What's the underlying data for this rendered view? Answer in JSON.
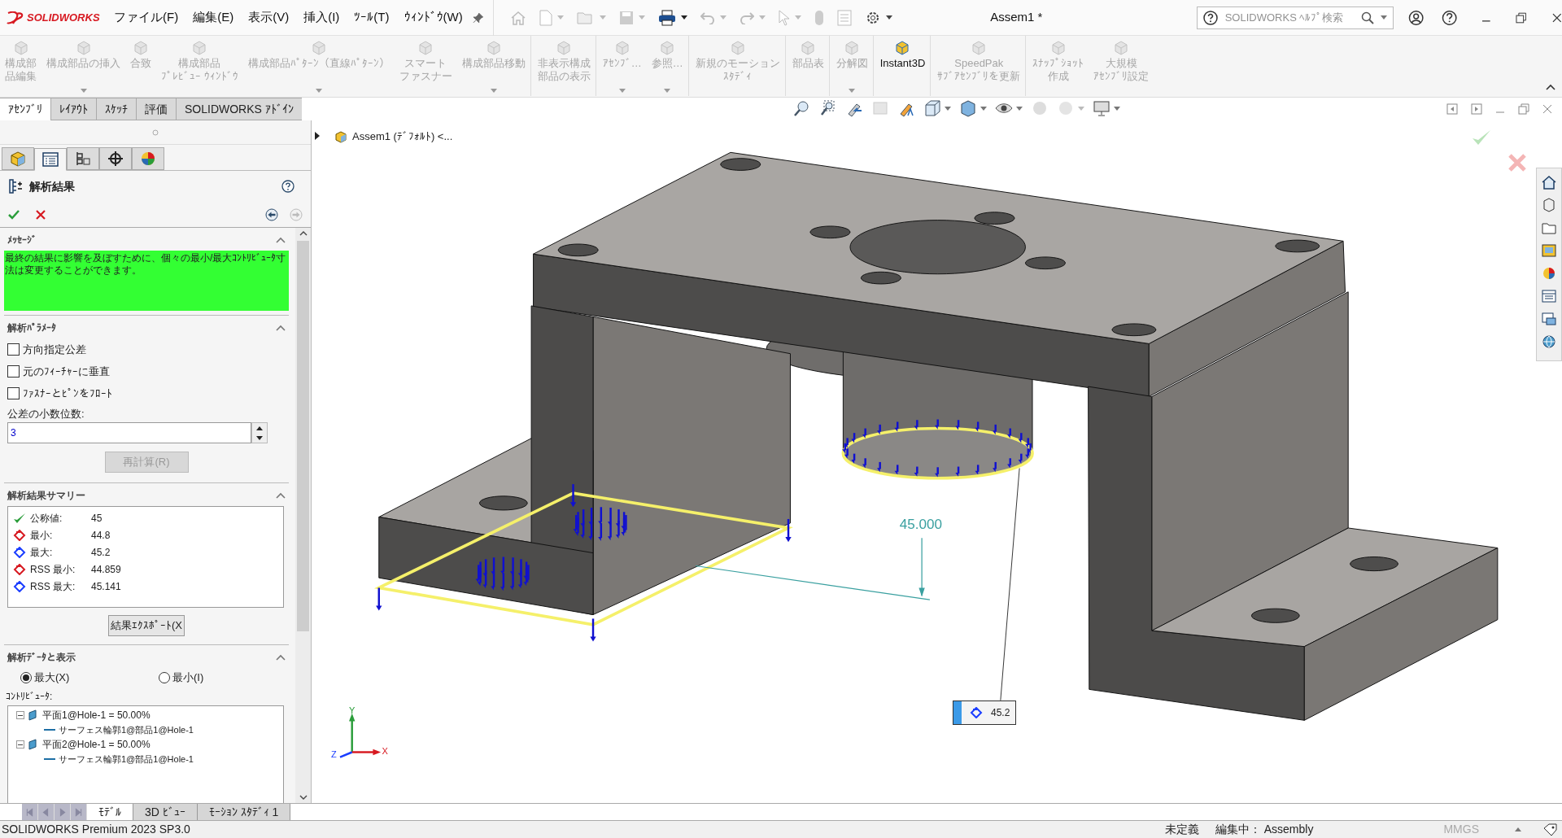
{
  "app": {
    "logo": "SOLIDWORKS"
  },
  "menu": [
    {
      "label": "ファイル(F)"
    },
    {
      "label": "編集(E)"
    },
    {
      "label": "表示(V)"
    },
    {
      "label": "挿入(I)"
    },
    {
      "label": "ﾂｰﾙ(T)"
    },
    {
      "label": "ｳｨﾝﾄﾞｳ(W)"
    }
  ],
  "title": "Assem1 *",
  "help_search": {
    "placeholder": "SOLIDWORKS ﾍﾙﾌﾟ検索"
  },
  "ribbon": [
    {
      "lines": [
        "構成部",
        "品編集"
      ],
      "disabled": true,
      "menu": false,
      "separator_after": false
    },
    {
      "lines": [
        "構成部品の挿入"
      ],
      "disabled": true,
      "menu": true,
      "separator_after": false
    },
    {
      "lines": [
        "合致"
      ],
      "disabled": true,
      "menu": false,
      "separator_after": false
    },
    {
      "lines": [
        "構成部品",
        "ﾌﾟﾚﾋﾞｭｰ ｳｨﾝﾄﾞｳ"
      ],
      "disabled": true,
      "menu": false,
      "separator_after": false
    },
    {
      "lines": [
        "構成部品ﾊﾟﾀｰﾝ（直線ﾊﾟﾀｰﾝ）"
      ],
      "disabled": true,
      "menu": true,
      "separator_after": false
    },
    {
      "lines": [
        "スマート",
        "ファスナー"
      ],
      "disabled": true,
      "menu": false,
      "separator_after": false
    },
    {
      "lines": [
        "構成部品移動"
      ],
      "disabled": true,
      "menu": true,
      "separator_after": true
    },
    {
      "lines": [
        "非表示構成",
        "部品の表示"
      ],
      "disabled": true,
      "menu": false,
      "separator_after": true
    },
    {
      "lines": [
        "ｱｾﾝﾌﾞ…"
      ],
      "disabled": true,
      "menu": true,
      "separator_after": false
    },
    {
      "lines": [
        "参照…"
      ],
      "disabled": true,
      "menu": true,
      "separator_after": true
    },
    {
      "lines": [
        "新規のモーション",
        "ｽﾀﾃﾞｨ"
      ],
      "disabled": true,
      "menu": false,
      "separator_after": true
    },
    {
      "lines": [
        "部品表"
      ],
      "disabled": true,
      "menu": false,
      "separator_after": true
    },
    {
      "lines": [
        "分解図"
      ],
      "disabled": true,
      "menu": true,
      "separator_after": true
    },
    {
      "lines": [
        "Instant3D"
      ],
      "disabled": false,
      "menu": false,
      "separator_after": true
    },
    {
      "lines": [
        "SpeedPak",
        "ｻﾌﾞｱｾﾝﾌﾞﾘを更新"
      ],
      "disabled": true,
      "menu": false,
      "separator_after": true
    },
    {
      "lines": [
        "ｽﾅｯﾌﾟｼｮｯﾄ",
        "作成"
      ],
      "disabled": true,
      "menu": false,
      "separator_after": false
    },
    {
      "lines": [
        "大規模",
        "ｱｾﾝﾌﾞﾘ設定"
      ],
      "disabled": true,
      "menu": false,
      "separator_after": false
    }
  ],
  "tabs": [
    {
      "label": "ｱｾﾝﾌﾞﾘ",
      "selected": true
    },
    {
      "label": "ﾚｲｱｳﾄ",
      "selected": false
    },
    {
      "label": "ｽｹｯﾁ",
      "selected": false
    },
    {
      "label": "評価",
      "selected": false
    },
    {
      "label": "SOLIDWORKS ｱﾄﾞｲﾝ",
      "selected": false
    }
  ],
  "panel_tabs": [
    {
      "kind": "feature_tree",
      "selected": false
    },
    {
      "kind": "property_manager",
      "selected": true
    },
    {
      "kind": "configuration",
      "selected": false
    },
    {
      "kind": "dimxpert",
      "selected": false
    },
    {
      "kind": "display",
      "selected": false
    }
  ],
  "property_manager": {
    "title": "解析結果",
    "message": {
      "heading": "ﾒｯｾｰｼﾞ",
      "text": "最終の結果に影響を及ぼすために、個々の最小/最大ｺﾝﾄﾘﾋﾞｭｰﾀ寸法は変更することができます。"
    },
    "parameters": {
      "heading": "解析ﾊﾟﾗﾒｰﾀ",
      "options": [
        {
          "label": "方向指定公差",
          "checked": false
        },
        {
          "label": "元のﾌｨｰﾁｬｰに垂直",
          "checked": false
        },
        {
          "label": "ﾌｧｽﾅｰとﾋﾟﾝをﾌﾛｰﾄ",
          "checked": false
        }
      ],
      "decimals_label": "公差の小数位数:",
      "decimals": "3",
      "recalc_button": {
        "label": "再計算(R)",
        "disabled": true
      }
    },
    "summary": {
      "heading": "解析結果サマリー",
      "rows": [
        {
          "kind": "nominal",
          "label": "公称値:",
          "value": "45"
        },
        {
          "kind": "min",
          "label": "最小:",
          "value": "44.8"
        },
        {
          "kind": "max",
          "label": "最大:",
          "value": "45.2"
        },
        {
          "kind": "min",
          "label": "RSS 最小:",
          "value": "44.859"
        },
        {
          "kind": "max",
          "label": "RSS 最大:",
          "value": "45.141"
        }
      ],
      "export_button": "結果ｴｸｽﾎﾟｰﾄ(X"
    },
    "display": {
      "heading": "解析ﾃﾞｰﾀと表示",
      "options": [
        {
          "label": "最大(X)",
          "selected": true
        },
        {
          "label": "最小(I)",
          "selected": false
        }
      ],
      "contributors_label": "ｺﾝﾄﾘﾋﾞｭｰﾀ:",
      "contributors": [
        {
          "label": "平面1@Hole-1 = 50.00%",
          "expanded": true,
          "children": [
            {
              "label": "サーフェス輪郭1@部品1@Hole-1"
            }
          ]
        },
        {
          "label": "平面2@Hole-1 = 50.00%",
          "expanded": true,
          "children": [
            {
              "label": "サーフェス輪郭1@部品1@Hole-1"
            }
          ]
        }
      ]
    }
  },
  "viewport": {
    "breadcrumb": "Assem1 (ﾃﾞﾌｫﾙﾄ) <...",
    "dimension": "45.000",
    "callout": "45.2",
    "triad": {
      "x": "X",
      "y": "Y",
      "z": "Z"
    }
  },
  "bottom_tabs": [
    {
      "label": "ﾓﾃﾞﾙ",
      "selected": true
    },
    {
      "label": "3D ﾋﾞｭｰ",
      "selected": false
    },
    {
      "label": "ﾓｰｼｮﾝ ｽﾀﾃﾞｨ 1",
      "selected": false
    }
  ],
  "status_bar": {
    "product": "SOLIDWORKS Premium 2023 SP3.0",
    "state": "未定義",
    "editing": "編集中： Assembly",
    "units": "MMGS"
  }
}
